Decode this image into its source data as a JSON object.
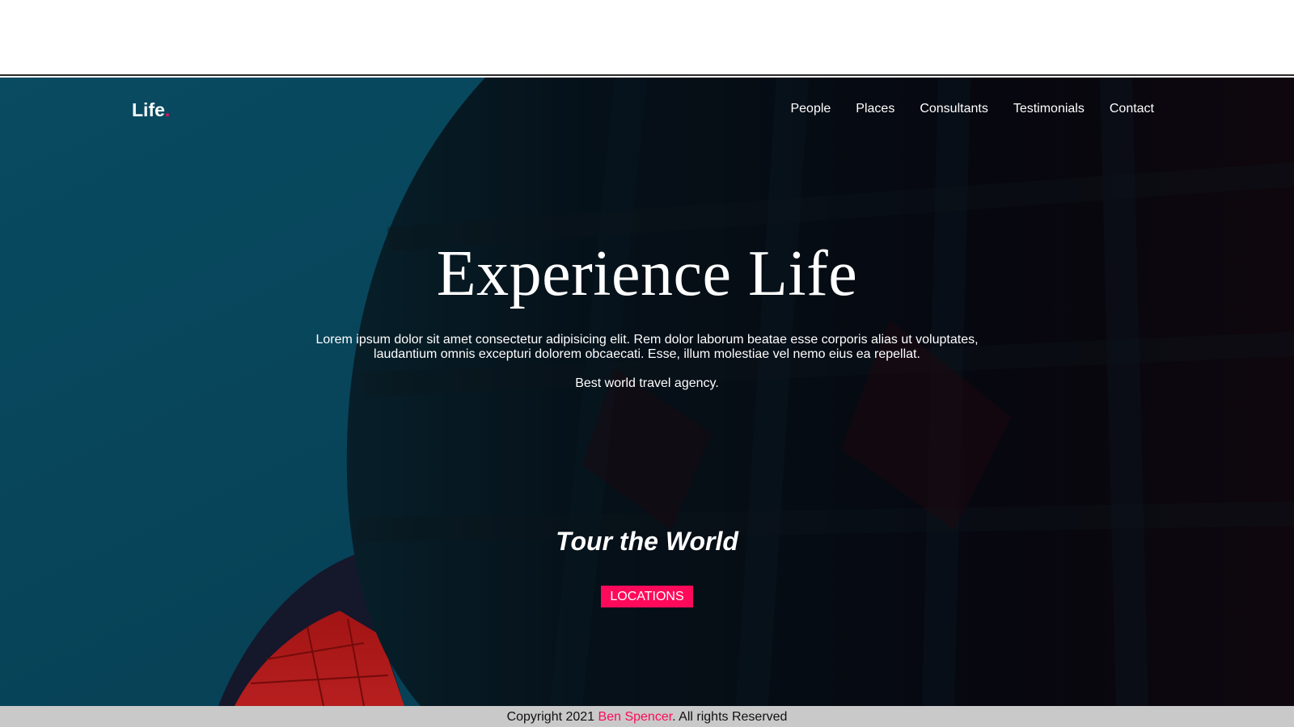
{
  "brand": {
    "name": "Life",
    "dot": ".",
    "dot_color": "#ff0a5a"
  },
  "nav": {
    "items": [
      {
        "label": "People"
      },
      {
        "label": "Places"
      },
      {
        "label": "Consultants"
      },
      {
        "label": "Testimonials"
      },
      {
        "label": "Contact"
      }
    ]
  },
  "hero": {
    "title": "Experience Life",
    "description": "Lorem ipsum dolor sit amet consectetur adipisicing elit. Rem dolor laborum beatae esse corporis alias ut voluptates, laudantium omnis excepturi dolorem obcaecati. Esse, illum molestiae vel nemo eius ea repellat.",
    "tagline": "Best world travel agency."
  },
  "tour": {
    "title": "Tour the World",
    "button_label": "LOCATIONS"
  },
  "footer": {
    "prefix": "Copyright 2021 ",
    "author": "Ben Spencer",
    "suffix": ". All rights Reserved"
  },
  "colors": {
    "accent": "#ff0a5a",
    "sky": "#0b5d78",
    "footer_bg": "#c9c9c9"
  }
}
